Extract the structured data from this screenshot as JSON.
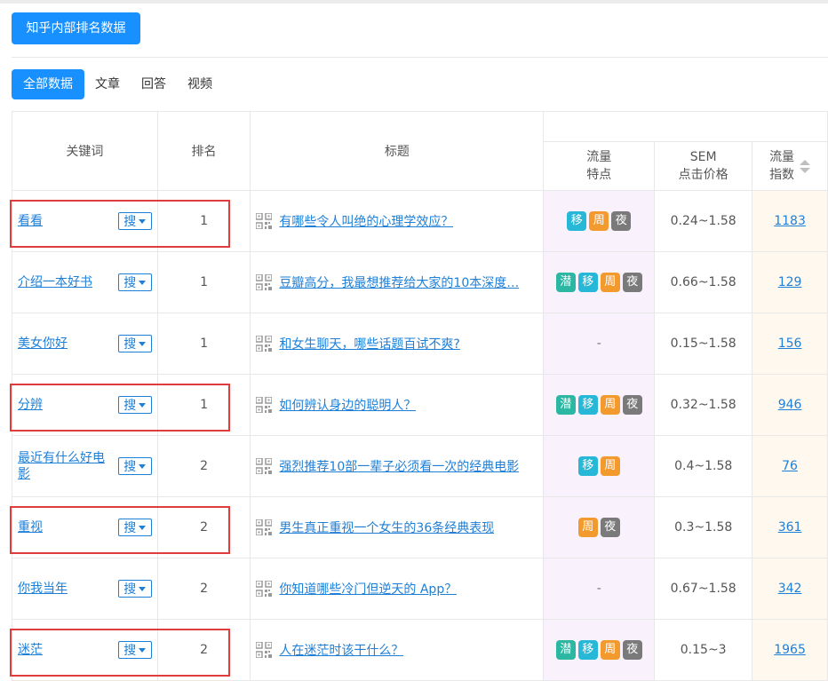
{
  "header": {
    "title_button": "知乎内部排名数据"
  },
  "tabs": [
    {
      "label": "全部数据",
      "active": true
    },
    {
      "label": "文章",
      "active": false
    },
    {
      "label": "回答",
      "active": false
    },
    {
      "label": "视频",
      "active": false
    }
  ],
  "columns": {
    "keyword": "关键词",
    "rank": "排名",
    "title": "标题",
    "traffic_line1": "流量",
    "traffic_line2": "特点",
    "sem_line1": "SEM",
    "sem_line2": "点击价格",
    "index_line1": "流量",
    "index_line2": "指数"
  },
  "search_btn_label": "搜",
  "badge_labels": {
    "qian": "潜",
    "yi": "移",
    "zhou": "周",
    "ye": "夜"
  },
  "rows": [
    {
      "keyword": "看看",
      "rank": "1",
      "title": "有哪些令人叫绝的心理学效应？",
      "badges": [
        "yi",
        "zhou",
        "ye"
      ],
      "sem": "0.24~1.58",
      "index": "1183",
      "highlighted": true
    },
    {
      "keyword": "介绍一本好书",
      "rank": "1",
      "title": "豆瓣高分，我最想推荐给大家的10本深度…",
      "badges": [
        "qian",
        "yi",
        "zhou",
        "ye"
      ],
      "sem": "0.66~1.58",
      "index": "129",
      "highlighted": false
    },
    {
      "keyword": "美女你好",
      "rank": "1",
      "title": "和女生聊天，哪些话题百试不爽?",
      "badges": [],
      "sem": "0.15~1.58",
      "index": "156",
      "highlighted": false
    },
    {
      "keyword": "分辨",
      "rank": "1",
      "title": "如何辨认身边的聪明人？",
      "badges": [
        "qian",
        "yi",
        "zhou",
        "ye"
      ],
      "sem": "0.32~1.58",
      "index": "946",
      "highlighted": true
    },
    {
      "keyword": "最近有什么好电影",
      "rank": "2",
      "title": "强烈推荐10部一辈子必须看一次的经典电影",
      "badges": [
        "yi",
        "zhou"
      ],
      "sem": "0.4~1.58",
      "index": "76",
      "highlighted": false
    },
    {
      "keyword": "重视",
      "rank": "2",
      "title": "男生真正重视一个女生的36条经典表现",
      "badges": [
        "zhou",
        "ye"
      ],
      "sem": "0.3~1.58",
      "index": "361",
      "highlighted": true
    },
    {
      "keyword": "你我当年",
      "rank": "2",
      "title": "你知道哪些冷门但逆天的 App？",
      "badges": [],
      "sem": "0.67~1.58",
      "index": "342",
      "highlighted": false
    },
    {
      "keyword": "迷茫",
      "rank": "2",
      "title": "人在迷茫时该干什么？",
      "badges": [
        "qian",
        "yi",
        "zhou",
        "ye"
      ],
      "sem": "0.15~3",
      "index": "1965",
      "highlighted": true
    }
  ],
  "empty_placeholder": "-",
  "colors": {
    "primary": "#1890ff",
    "link": "#1e7fd7",
    "badge_qian": "#2cb7a3",
    "badge_yi": "#26b8d6",
    "badge_zhou": "#f29a2e",
    "badge_ye": "#7a7a7a",
    "highlight_box": "#e03c3c"
  }
}
